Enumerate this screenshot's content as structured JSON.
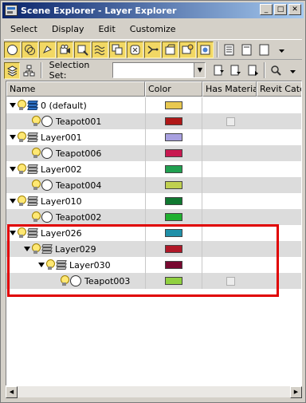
{
  "window": {
    "title": "Scene Explorer - Layer Explorer"
  },
  "title_buttons": [
    "_",
    "□",
    "✕"
  ],
  "menu": [
    "Select",
    "Display",
    "Edit",
    "Customize"
  ],
  "toolbar1_icons": [
    "sphere-icon",
    "display-all-icon",
    "lights-icon",
    "cameras-icon",
    "helpers-icon",
    "spacewarps-icon",
    "groups-icon",
    "xrefs-icon",
    "bones-icon",
    "layers-icon",
    "container-icon",
    "options-icon",
    "list-view-icon",
    "detail-view-icon",
    "more-view-icon"
  ],
  "toolbar2": {
    "selection_set_label": "Selection Set:",
    "selection_set_value": ""
  },
  "columns": [
    "Name",
    "Color",
    "Has Material",
    "Revit Categ"
  ],
  "rows": [
    {
      "name": "0 (default)",
      "type": "layer",
      "level": 0,
      "expanded": true,
      "color": "#e8c850",
      "active_layer": true
    },
    {
      "name": "Teapot001",
      "type": "object",
      "level": 1,
      "color": "#b01818",
      "has_material": false
    },
    {
      "name": "Layer001",
      "type": "layer",
      "level": 0,
      "expanded": true,
      "color": "#a8a0e0"
    },
    {
      "name": "Teapot006",
      "type": "object",
      "level": 1,
      "color": "#c81850"
    },
    {
      "name": "Layer002",
      "type": "layer",
      "level": 0,
      "expanded": true,
      "color": "#20a050"
    },
    {
      "name": "Teapot004",
      "type": "object",
      "level": 1,
      "color": "#c0d050"
    },
    {
      "name": "Layer010",
      "type": "layer",
      "level": 0,
      "expanded": true,
      "color": "#107830"
    },
    {
      "name": "Teapot002",
      "type": "object",
      "level": 1,
      "color": "#20b030"
    },
    {
      "name": "Layer026",
      "type": "layer",
      "level": 0,
      "expanded": true,
      "color": "#2090a8"
    },
    {
      "name": "Layer029",
      "type": "layer",
      "level": 1,
      "expanded": true,
      "color": "#b01828"
    },
    {
      "name": "Layer030",
      "type": "layer",
      "level": 2,
      "expanded": true,
      "color": "#780830"
    },
    {
      "name": "Teapot003",
      "type": "object",
      "level": 3,
      "color": "#90d040",
      "has_material": false
    }
  ]
}
